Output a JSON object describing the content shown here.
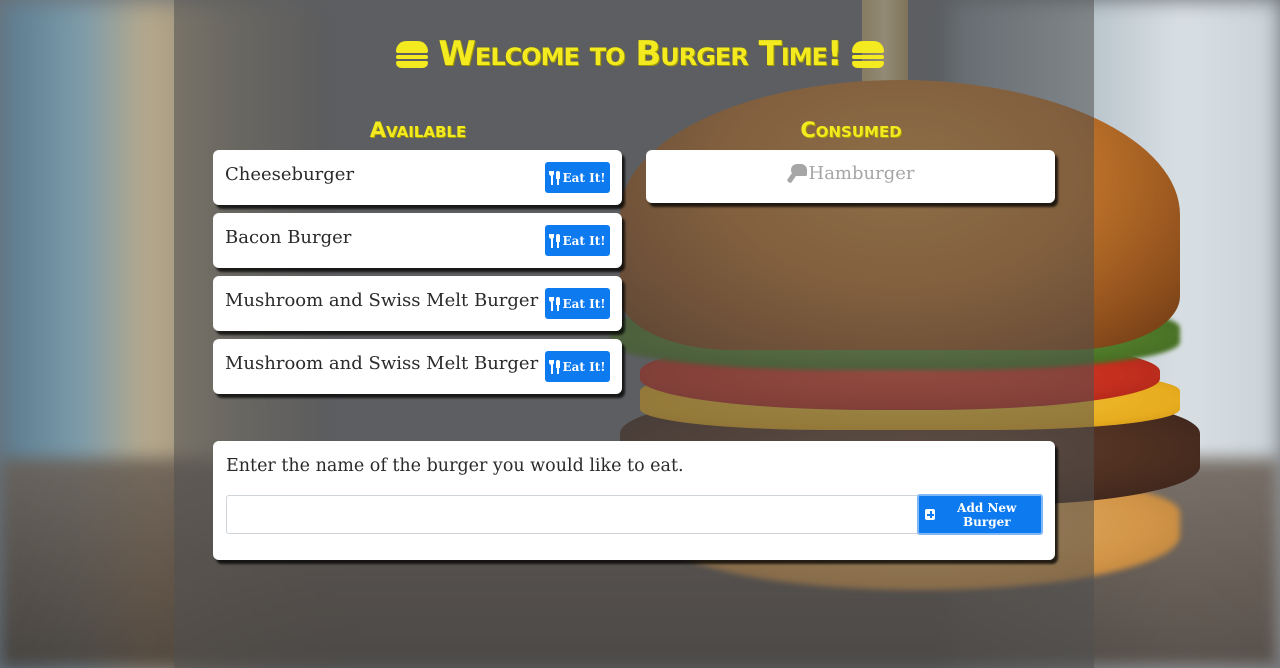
{
  "header": {
    "title": "Welcome to Burger Time!"
  },
  "columns": {
    "available_heading": "Available",
    "consumed_heading": "Consumed"
  },
  "available_burgers": [
    {
      "name": "Cheeseburger",
      "button_label": "Eat It!"
    },
    {
      "name": "Bacon Burger",
      "button_label": "Eat It!"
    },
    {
      "name": "Mushroom and Swiss Melt Burger",
      "button_label": "Eat It!"
    },
    {
      "name": "Mushroom and Swiss Melt Burger",
      "button_label": "Eat It!"
    }
  ],
  "consumed_burgers": [
    {
      "name": "Hamburger",
      "icon": "drumstick-bite-icon"
    }
  ],
  "form": {
    "label": "Enter the name of the burger you would like to eat.",
    "input_value": "",
    "submit_label": "Add New Burger"
  },
  "colors": {
    "accent_yellow": "#f3ea1f",
    "button_blue": "#0d7af0",
    "consumed_text": "#a6a6a6"
  }
}
